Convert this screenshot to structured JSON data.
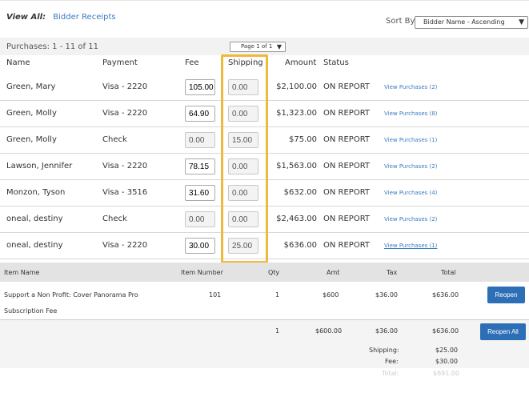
{
  "header": {
    "view_all_label": "View All:",
    "view_all_link": "Bidder Receipts",
    "sort_label": "Sort By:",
    "sort_value": "Bidder Name - Ascending"
  },
  "pager": {
    "count": "Purchases: 1 - 11 of 11",
    "page": "Page 1 of 1"
  },
  "columns": {
    "name": "Name",
    "payment": "Payment",
    "fee": "Fee",
    "shipping": "Shipping",
    "amount": "Amount",
    "status": "Status"
  },
  "rows": [
    {
      "name": "Green, Mary",
      "payment": "Visa - 2220",
      "fee": "105.00",
      "shipping": "0.00",
      "amount": "$2,100.00",
      "status": "ON REPORT",
      "link": "View Purchases (2)"
    },
    {
      "name": "Green, Molly",
      "payment": "Visa - 2220",
      "fee": "64.90",
      "shipping": "0.00",
      "amount": "$1,323.00",
      "status": "ON REPORT",
      "link": "View Purchases (8)"
    },
    {
      "name": "Green, Molly",
      "payment": "Check",
      "fee": "0.00",
      "shipping": "15.00",
      "amount": "$75.00",
      "status": "ON REPORT",
      "link": "View Purchases (1)"
    },
    {
      "name": "Lawson, Jennifer",
      "payment": "Visa - 2220",
      "fee": "78.15",
      "shipping": "0.00",
      "amount": "$1,563.00",
      "status": "ON REPORT",
      "link": "View Purchases (2)"
    },
    {
      "name": "Monzon, Tyson",
      "payment": "Visa - 3516",
      "fee": "31.60",
      "shipping": "0.00",
      "amount": "$632.00",
      "status": "ON REPORT",
      "link": "View Purchases (4)"
    },
    {
      "name": "oneal, destiny",
      "payment": "Check",
      "fee": "0.00",
      "shipping": "0.00",
      "amount": "$2,463.00",
      "status": "ON REPORT",
      "link": "View Purchases (2)"
    },
    {
      "name": "oneal, destiny",
      "payment": "Visa - 2220",
      "fee": "30.00",
      "shipping": "25.00",
      "amount": "$636.00",
      "status": "ON REPORT",
      "link": "View Purchases (1)"
    }
  ],
  "detail": {
    "headers": {
      "item_name": "Item Name",
      "item_number": "Item Number",
      "qty": "Qty",
      "amt": "Amt",
      "tax": "Tax",
      "total": "Total"
    },
    "item": {
      "name_line1": "Support a Non Profit: Cover Panorama Pro",
      "name_line2": "Subscription Fee",
      "number": "101",
      "qty": "1",
      "amt": "$600",
      "tax": "$36.00",
      "total": "$636.00",
      "button": "Reopen"
    },
    "totals": {
      "qty": "1",
      "amt": "$600.00",
      "tax": "$36.00",
      "total": "$636.00",
      "button": "Reopen All",
      "shipping_label": "Shipping:",
      "shipping_value": "$25.00",
      "fee_label": "Fee:",
      "fee_value": "$30.00",
      "total_label": "Total:",
      "total_value": "$691.00"
    }
  },
  "colors": {
    "highlight": "#efb93a",
    "link": "#3a7bbf",
    "button": "#2d6fb7"
  }
}
